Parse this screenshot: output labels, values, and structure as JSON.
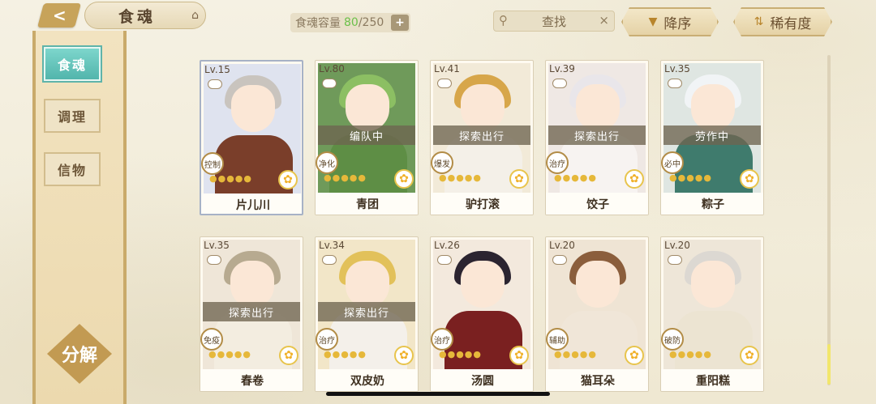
{
  "header": {
    "back_icon": "back-arrow-icon",
    "title": "食魂",
    "capacity_label": "食魂容量",
    "capacity_current": "80",
    "capacity_total": "/250",
    "capacity_plus": "+",
    "search_placeholder": "查找",
    "search_clear": "×",
    "sort_order": "降序",
    "sort_rarity": "稀有度"
  },
  "sidebar": {
    "items": [
      {
        "label": "食魂",
        "active": true
      },
      {
        "label": "调理",
        "active": false
      },
      {
        "label": "信物",
        "active": false
      }
    ],
    "decompose_label": "分解"
  },
  "cards": [
    {
      "level": "Lv.15",
      "status": "",
      "role": "控制",
      "name": "片儿川"
    },
    {
      "level": "Lv.80",
      "status": "编队中",
      "role": "净化",
      "name": "青团"
    },
    {
      "level": "Lv.41",
      "status": "探索出行",
      "role": "爆发",
      "name": "驴打滚"
    },
    {
      "level": "Lv.39",
      "status": "探索出行",
      "role": "治疗",
      "name": "饺子"
    },
    {
      "level": "Lv.35",
      "status": "劳作中",
      "role": "必中",
      "name": "粽子"
    },
    {
      "level": "Lv.35",
      "status": "探索出行",
      "role": "免疫",
      "name": "春卷"
    },
    {
      "level": "Lv.34",
      "status": "探索出行",
      "role": "治疗",
      "name": "双皮奶"
    },
    {
      "level": "Lv.26",
      "status": "",
      "role": "治疗",
      "name": "汤圆"
    },
    {
      "level": "Lv.20",
      "status": "",
      "role": "辅助",
      "name": "猫耳朵"
    },
    {
      "level": "Lv.20",
      "status": "",
      "role": "破防",
      "name": "重阳糕"
    }
  ],
  "colors": {
    "accent_teal": "#5fb4aa",
    "gold": "#c9aa6a",
    "capacity_green": "#6cc04a"
  }
}
